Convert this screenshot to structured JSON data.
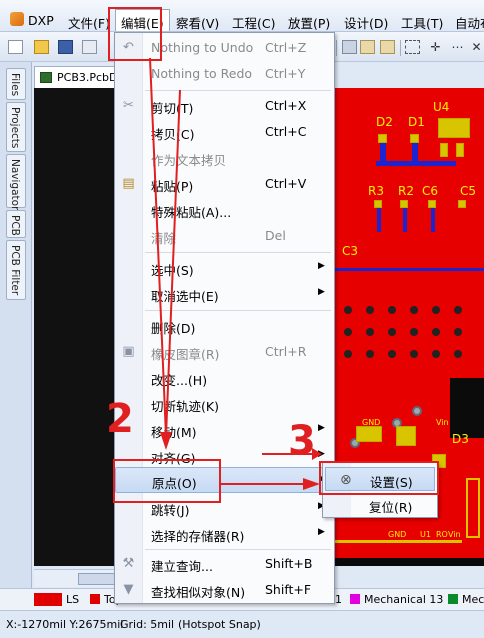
{
  "menubar": {
    "items": [
      "DXP",
      "文件(F)",
      "编辑(E)",
      "察看(V)",
      "工程(C)",
      "放置(P)",
      "设计(D)",
      "工具(T)",
      "自动布"
    ]
  },
  "sidebar": {
    "tabs": [
      "Files",
      "Projects",
      "Navigator",
      "PCB",
      "PCB Filter"
    ]
  },
  "document": {
    "tab_label": "PCB3.PcbDoc"
  },
  "pcb": {
    "labels": [
      "U4",
      "D2",
      "D1",
      "R3",
      "R2",
      "C6",
      "C5",
      "C3",
      "D3",
      "GND",
      "Vin",
      "GND",
      "U1",
      "RO",
      "Vin"
    ]
  },
  "edit_menu": {
    "items": [
      {
        "label": "Nothing to Undo",
        "shortcut": "Ctrl+Z",
        "icon": "undo-icon",
        "disabled": true
      },
      {
        "label": "Nothing to Redo",
        "shortcut": "Ctrl+Y",
        "icon": "",
        "disabled": true
      },
      {
        "label": "剪切(T)",
        "shortcut": "Ctrl+X",
        "icon": "scissors-icon",
        "disabled": false
      },
      {
        "label": "拷贝(C)",
        "shortcut": "Ctrl+C",
        "icon": "",
        "disabled": false
      },
      {
        "label": "作为文本拷贝",
        "shortcut": "",
        "icon": "",
        "disabled": true
      },
      {
        "label": "粘贴(P)",
        "shortcut": "Ctrl+V",
        "icon": "paste-icon",
        "disabled": false
      },
      {
        "label": "特殊粘贴(A)...",
        "shortcut": "",
        "icon": "",
        "disabled": false
      },
      {
        "label": "清除",
        "shortcut": "Del",
        "icon": "",
        "disabled": true
      },
      {
        "label": "选中(S)",
        "shortcut": "",
        "icon": "",
        "disabled": false,
        "submenu": true
      },
      {
        "label": "取消选中(E)",
        "shortcut": "",
        "icon": "",
        "disabled": false,
        "submenu": true
      },
      {
        "label": "删除(D)",
        "shortcut": "",
        "icon": "",
        "disabled": false
      },
      {
        "label": "橡皮图章(R)",
        "shortcut": "Ctrl+R",
        "icon": "stamp-icon",
        "disabled": true
      },
      {
        "label": "改变...(H)",
        "shortcut": "",
        "icon": "",
        "disabled": false
      },
      {
        "label": "切断轨迹(K)",
        "shortcut": "",
        "icon": "",
        "disabled": false
      },
      {
        "label": "移动(M)",
        "shortcut": "",
        "icon": "",
        "disabled": false,
        "submenu": true
      },
      {
        "label": "对齐(G)",
        "shortcut": "",
        "icon": "",
        "disabled": false,
        "submenu": true
      },
      {
        "label": "原点(O)",
        "shortcut": "",
        "icon": "",
        "disabled": false,
        "submenu": true,
        "highlighted": true
      },
      {
        "label": "跳转(J)",
        "shortcut": "",
        "icon": "",
        "disabled": false,
        "submenu": true
      },
      {
        "label": "选择的存储器(R)",
        "shortcut": "",
        "icon": "",
        "disabled": false,
        "submenu": true
      },
      {
        "label": "建立查询...",
        "shortcut": "Shift+B",
        "icon": "wrench-icon",
        "disabled": false
      },
      {
        "label": "查找相似对象(N)",
        "shortcut": "Shift+F",
        "icon": "filter-icon",
        "disabled": false
      }
    ]
  },
  "origin_submenu": {
    "items": [
      {
        "label": "设置(S)",
        "highlighted": true
      },
      {
        "label": "复位(R)",
        "highlighted": false
      }
    ]
  },
  "annotations": {
    "steps": [
      "2",
      "3"
    ]
  },
  "layers": {
    "current": "LS",
    "items": [
      "Top",
      "1",
      "Mechanical 13",
      "Mec"
    ]
  },
  "status": {
    "coords": "X:-1270mil Y:2675mil",
    "grid": "Grid: 5mil",
    "snap": "(Hotspot Snap)"
  },
  "colors": {
    "accent": "#e02020",
    "board": "#e60000",
    "highlight": "#c6daf4"
  }
}
